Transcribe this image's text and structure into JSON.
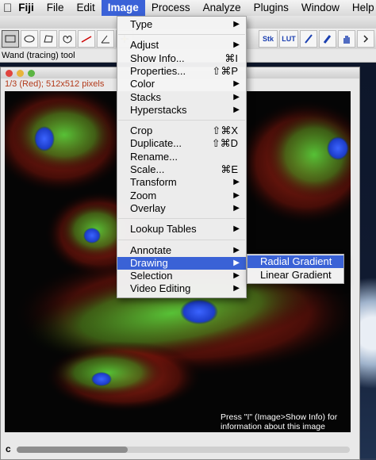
{
  "menubar": {
    "items": [
      {
        "label": "Fiji"
      },
      {
        "label": "File"
      },
      {
        "label": "Edit"
      },
      {
        "label": "Image"
      },
      {
        "label": "Process"
      },
      {
        "label": "Analyze"
      },
      {
        "label": "Plugins"
      },
      {
        "label": "Window"
      },
      {
        "label": "Help"
      }
    ],
    "active": "Image"
  },
  "toolbar": {
    "status": "Wand (tracing) tool",
    "tools": [
      "rectangle-icon",
      "oval-icon",
      "polygon-icon",
      "freehand-icon",
      "line-icon",
      "angle-icon",
      "point-icon"
    ],
    "right_tools": [
      "Stk",
      "LUT"
    ]
  },
  "image_window": {
    "info": "1/3 (Red); 512x512 pixels",
    "hint": "Press \"I\" (Image>Show Info) for information about this image",
    "channel": "c"
  },
  "image_menu": {
    "items": [
      {
        "label": "Type",
        "submenu": true
      },
      {
        "sep": true
      },
      {
        "label": "Adjust",
        "submenu": true
      },
      {
        "label": "Show Info...",
        "shortcut": "⌘I"
      },
      {
        "label": "Properties...",
        "shortcut": "⇧⌘P"
      },
      {
        "label": "Color",
        "submenu": true
      },
      {
        "label": "Stacks",
        "submenu": true
      },
      {
        "label": "Hyperstacks",
        "submenu": true
      },
      {
        "sep": true
      },
      {
        "label": "Crop",
        "shortcut": "⇧⌘X"
      },
      {
        "label": "Duplicate...",
        "shortcut": "⇧⌘D"
      },
      {
        "label": "Rename..."
      },
      {
        "label": "Scale...",
        "shortcut": "⌘E"
      },
      {
        "label": "Transform",
        "submenu": true
      },
      {
        "label": "Zoom",
        "submenu": true
      },
      {
        "label": "Overlay",
        "submenu": true
      },
      {
        "sep": true
      },
      {
        "label": "Lookup Tables",
        "submenu": true
      },
      {
        "sep": true
      },
      {
        "label": "Annotate",
        "submenu": true
      },
      {
        "label": "Drawing",
        "submenu": true,
        "active": true
      },
      {
        "label": "Selection",
        "submenu": true
      },
      {
        "label": "Video Editing",
        "submenu": true
      }
    ]
  },
  "drawing_submenu": {
    "items": [
      {
        "label": "Radial Gradient",
        "active": true
      },
      {
        "label": "Linear Gradient"
      }
    ]
  },
  "colors": {
    "accent": "#3a62d6",
    "info_text": "#b33a1a"
  }
}
